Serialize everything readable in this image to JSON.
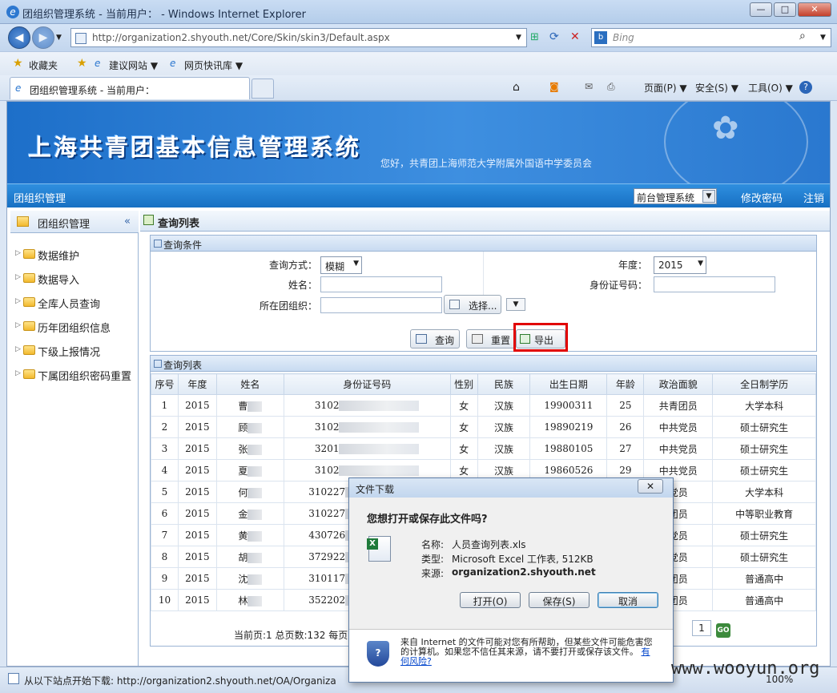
{
  "window": {
    "title": "团组织管理系统 - 当前用户： - Windows Internet Explorer",
    "min": "—",
    "max": "□",
    "close": "✕"
  },
  "browser": {
    "url": "http://organization2.shyouth.net/Core/Skin/skin3/Default.aspx",
    "search_placeholder": "Bing",
    "favorites": "收藏夹",
    "fav_links": [
      "建议网站 ▼",
      "网页快讯库 ▼"
    ],
    "tab_title": "团组织管理系统 - 当前用户：",
    "commands": [
      "页面(P) ▼",
      "安全(S) ▼",
      "工具(O) ▼"
    ],
    "status": "从以下站点开始下载: http://organization2.shyouth.net/OA/Organiza",
    "zoom": "100%"
  },
  "app": {
    "banner_title": "上海共青团基本信息管理系统",
    "welcome": "您好，共青团上海师范大学附属外国语中学委员会",
    "menu_org": "团组织管理",
    "system_select": "前台管理系统",
    "change_pwd": "修改密码",
    "logout": "注销"
  },
  "sidebar": {
    "title": "团组织管理",
    "collapse": "«",
    "items": [
      "数据维护",
      "数据导入",
      "全库人员查询",
      "历年团组织信息",
      "下级上报情况",
      "下属团组织密码重置"
    ]
  },
  "main": {
    "title": "查询列表",
    "query": {
      "title": "查询条件",
      "mode_label": "查询方式：",
      "mode_value": "模糊",
      "year_label": "年度：",
      "year_value": "2015",
      "name_label": "姓名：",
      "id_label": "身份证号码：",
      "org_label": "所在团组织：",
      "choose_btn": "选择...",
      "search_btn": "查询",
      "reset_btn": "重置",
      "export_btn": "导出"
    },
    "list": {
      "title": "查询列表",
      "columns": [
        "序号",
        "年度",
        "姓名",
        "身份证号码",
        "性别",
        "民族",
        "出生日期",
        "年龄",
        "政治面貌",
        "全日制学历"
      ],
      "rows": [
        [
          "1",
          "2015",
          "曹",
          "3102",
          "女",
          "汉族",
          "19900311",
          "25",
          "共青团员",
          "大学本科"
        ],
        [
          "2",
          "2015",
          "顾",
          "3102",
          "女",
          "汉族",
          "19890219",
          "26",
          "中共党员",
          "硕士研究生"
        ],
        [
          "3",
          "2015",
          "张",
          "3201",
          "女",
          "汉族",
          "19880105",
          "27",
          "中共党员",
          "硕士研究生"
        ],
        [
          "4",
          "2015",
          "夏",
          "3102",
          "女",
          "汉族",
          "19860526",
          "29",
          "中共党员",
          "硕士研究生"
        ],
        [
          "5",
          "2015",
          "何",
          "310227",
          "",
          "",
          "",
          "",
          "党员",
          "大学本科"
        ],
        [
          "6",
          "2015",
          "金",
          "310227",
          "",
          "",
          "",
          "",
          "团员",
          "中等职业教育"
        ],
        [
          "7",
          "2015",
          "黄",
          "430726",
          "",
          "",
          "",
          "",
          "党员",
          "硕士研究生"
        ],
        [
          "8",
          "2015",
          "胡",
          "372922",
          "",
          "",
          "",
          "",
          "党员",
          "硕士研究生"
        ],
        [
          "9",
          "2015",
          "沈",
          "310117",
          "",
          "",
          "",
          "",
          "团员",
          "普通高中"
        ],
        [
          "10",
          "2015",
          "林",
          "352202",
          "",
          "",
          "",
          "",
          "团员",
          "普通高中"
        ]
      ],
      "pager_text": "当前页:1 总页数:132 每页",
      "page_input": "1",
      "go_btn": "GO"
    }
  },
  "dialog": {
    "title": "文件下载",
    "close": "✕",
    "question": "您想打开或保存此文件吗?",
    "name_label": "名称:",
    "name_value": "人员查询列表.xls",
    "type_label": "类型:",
    "type_value": "Microsoft Excel 工作表, 512KB",
    "source_label": "来源:",
    "source_value": "organization2.shyouth.net",
    "open_btn": "打开(O)",
    "save_btn": "保存(S)",
    "cancel_btn": "取消",
    "warning": "来自 Internet 的文件可能对您有所帮助，但某些文件可能危害您的计算机。如果您不信任其来源，请不要打开或保存该文件。",
    "risk_link": "有何风险?"
  },
  "watermark": "www.wooyun.org"
}
